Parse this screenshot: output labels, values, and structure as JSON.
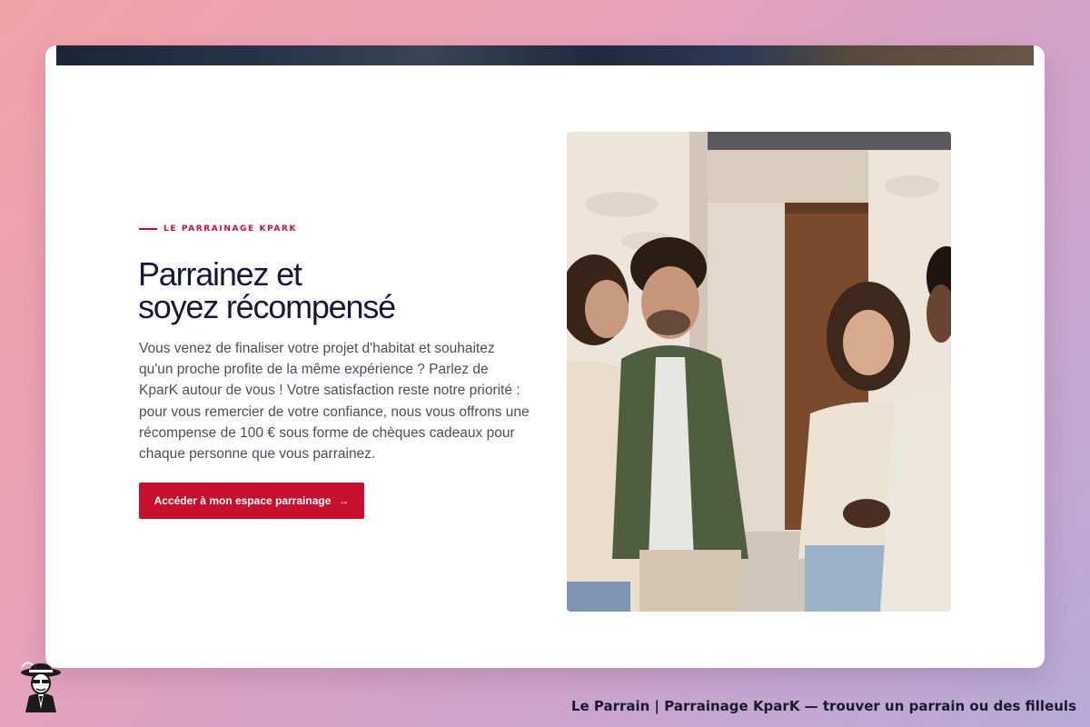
{
  "section": {
    "eyebrow": "LE PARRAINAGE KPARK",
    "title_line1": "Parrainez et",
    "title_line2": "soyez récompensé",
    "description": "Vous venez de finaliser votre projet d'habitat et souhaitez qu'un proche profite de la même expérience ? Parlez de KparK autour de vous ! Votre satisfaction reste notre priorité : pour vous remercier de votre confiance, nous vous offrons une récompense de 100 € sous forme de chèques cadeaux pour chaque personne que vous parrainez.",
    "cta_label": "Accéder à mon espace parrainage",
    "cta_arrow": "→"
  },
  "footer": {
    "title": "Le Parrain | Parrainage KparK — trouver un parrain ou des filleuls"
  },
  "icons": {
    "mascot": "godfather-mascot-icon",
    "arrow": "arrow-right-icon"
  },
  "colors": {
    "accent": "#c8102e",
    "heading": "#141a3c",
    "body_text": "#4a4d5c"
  }
}
